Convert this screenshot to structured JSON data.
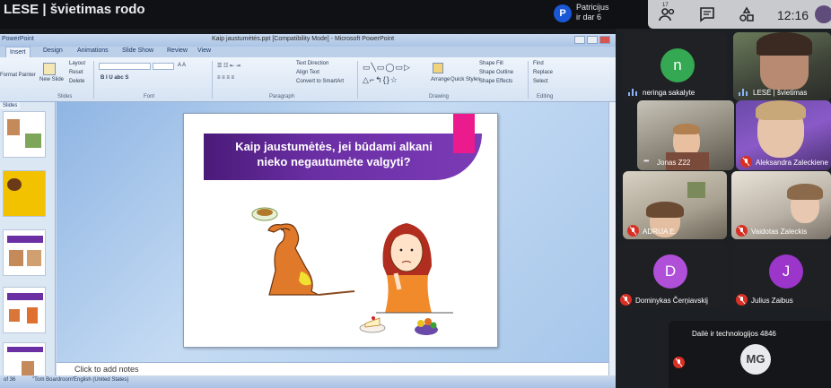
{
  "topbar": {
    "presenting_label": "LESE | švietimas rodo",
    "presenter_avatar_letter": "P",
    "others_line1": "Patricijus",
    "others_line2": "ir dar 6",
    "participants_badge": "17",
    "clock": "12:16"
  },
  "ppt": {
    "app_label": "PowerPoint",
    "window_title": "Kaip jaustumėtės.ppt [Compatibility Mode] - Microsoft PowerPoint",
    "tabs": [
      "Insert",
      "Design",
      "Animations",
      "Slide Show",
      "Review",
      "View"
    ],
    "ribbon": {
      "layout": "Layout",
      "reset": "Reset",
      "delete": "Delete",
      "new_slide": "New Slide",
      "format_painter": "Format Painter",
      "group_slides": "Slides",
      "group_font": "Font",
      "group_paragraph": "Paragraph",
      "group_drawing": "Drawing",
      "group_editing": "Editing",
      "text_direction": "Text Direction",
      "align_text": "Align Text",
      "convert_smartart": "Convert to SmartArt",
      "arrange": "Arrange",
      "quick_styles": "Quick Styles",
      "shape_fill": "Shape Fill",
      "shape_outline": "Shape Outline",
      "shape_effects": "Shape Effects",
      "find": "Find",
      "replace": "Replace",
      "select": "Select"
    },
    "slide": {
      "title_line1": "Kaip jaustumėtės, jei būdami alkani",
      "title_line2": "nieko negautumėte valgyti?"
    },
    "thumbnails_tab": "Slides",
    "notes_placeholder": "Click to add notes",
    "status": {
      "slide_count": "of 36",
      "theme": "\"Tom Boardroom\"",
      "language": "English (United States)"
    }
  },
  "participants": [
    {
      "name": "neringa sakalyte",
      "type": "avatar",
      "letter": "n",
      "color": "#34a853",
      "audio": "speaking"
    },
    {
      "name": "LESĖ | švietimas",
      "type": "camera",
      "audio": "speaking"
    },
    {
      "name": "Jonas Z22",
      "type": "camera",
      "audio": "dots"
    },
    {
      "name": "Aleksandra Zaleckiene",
      "type": "camera",
      "audio": "muted"
    },
    {
      "name": "ADRIJA E.",
      "type": "camera",
      "audio": "muted"
    },
    {
      "name": "Vaidotas Zaleckis",
      "type": "camera",
      "audio": "muted"
    },
    {
      "name": "Dominykas Čerņiavskij",
      "type": "avatar",
      "letter": "D",
      "color": "#b04fd8",
      "audio": "muted"
    },
    {
      "name": "Julius Zaibus",
      "type": "avatar",
      "letter": "J",
      "color": "#9c35c9",
      "audio": "muted"
    },
    {
      "name": "Dailė ir technologijos 4846",
      "type": "avatar",
      "letter": "MG",
      "color": "#e8eaed",
      "audio": "muted"
    }
  ],
  "colors": {
    "slide_banner": "#5b2490",
    "slide_accent": "#ec1b8d",
    "mute_red": "#d93025"
  }
}
